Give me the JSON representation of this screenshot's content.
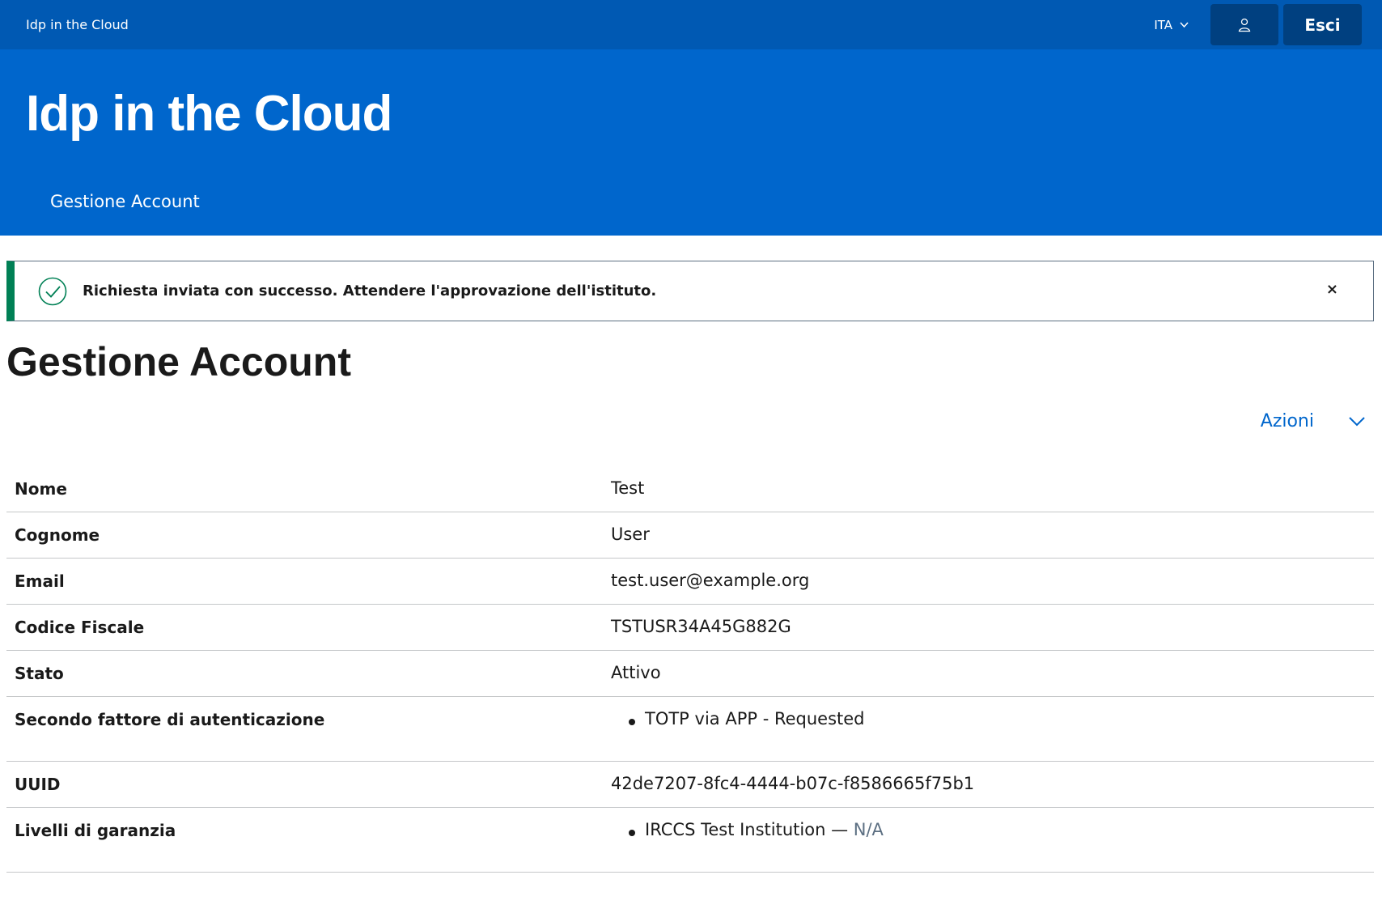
{
  "topbar": {
    "brand": "Idp in the Cloud",
    "language": "ITA",
    "logout_label": "Esci"
  },
  "hero": {
    "title": "Idp in the Cloud",
    "nav_item": "Gestione Account"
  },
  "alert": {
    "message": "Richiesta inviata con successo. Attendere l'approvazione dell'istituto.",
    "close_symbol": "×"
  },
  "page": {
    "title": "Gestione Account",
    "actions_label": "Azioni"
  },
  "account": {
    "rows": [
      {
        "label": "Nome",
        "value": "Test"
      },
      {
        "label": "Cognome",
        "value": "User"
      },
      {
        "label": "Email",
        "value": "test.user@example.org"
      },
      {
        "label": "Codice Fiscale",
        "value": "TSTUSR34A45G882G"
      },
      {
        "label": "Stato",
        "value": "Attivo"
      },
      {
        "label": "Secondo fattore di autenticazione",
        "items": [
          "TOTP via APP - Requested"
        ]
      },
      {
        "label": "UUID",
        "value": "42de7207-8fc4-4444-b07c-f8586665f75b1"
      },
      {
        "label": "Livelli di garanzia",
        "items": [
          {
            "name": "IRCCS Test Institution",
            "separator": " — ",
            "level": "N/A"
          }
        ]
      }
    ]
  },
  "colors": {
    "topbar": "#0059b3",
    "hero": "#0066cc",
    "button_dark": "#004080",
    "success": "#008055",
    "link": "#0066cc"
  },
  "icons": {
    "user": "user-icon",
    "chevron": "chevron-down-icon",
    "success": "check-circle-icon",
    "close": "close-icon"
  }
}
